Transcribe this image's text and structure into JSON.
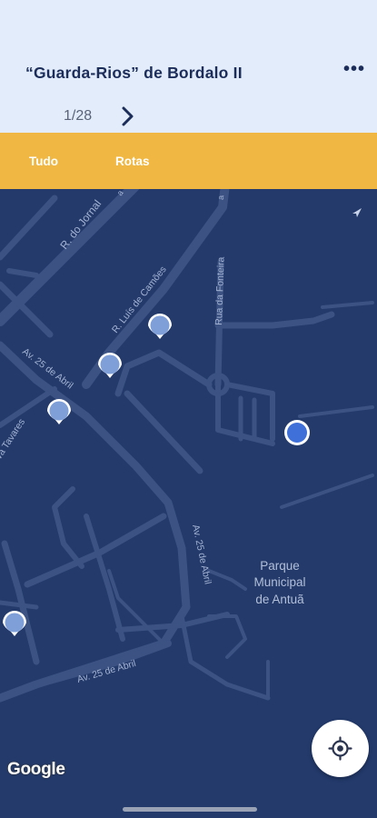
{
  "header": {
    "title": "“Guarda-Rios” de Bordalo II",
    "more_icon": "more-horizontal-icon",
    "pager": {
      "current": 1,
      "total": 28,
      "label": "1/28"
    }
  },
  "tabs": [
    {
      "label": "Tudo"
    },
    {
      "label": "Rotas"
    }
  ],
  "map": {
    "streets": [
      "R. do Jornal",
      "R. Luís de Camões",
      "Rua da Fonteira",
      "Av. 25 de Abril",
      "va Tavares",
      "Av. 25 de Abril",
      "Av. 25 de Abril"
    ],
    "poi_label": [
      "Parque",
      "Municipal",
      "de Antuã"
    ],
    "attribution": "Google",
    "colors": {
      "background": "#233a6b",
      "road": "#3b5283",
      "marker": "#7f9fd8",
      "selected_marker": "#3f6fd8"
    }
  },
  "locate_button_icon": "gps-crosshair-icon",
  "colors": {
    "header_bg": "#e2ecfa",
    "tab_bar": "#f0b843",
    "title": "#1c2d5a"
  }
}
